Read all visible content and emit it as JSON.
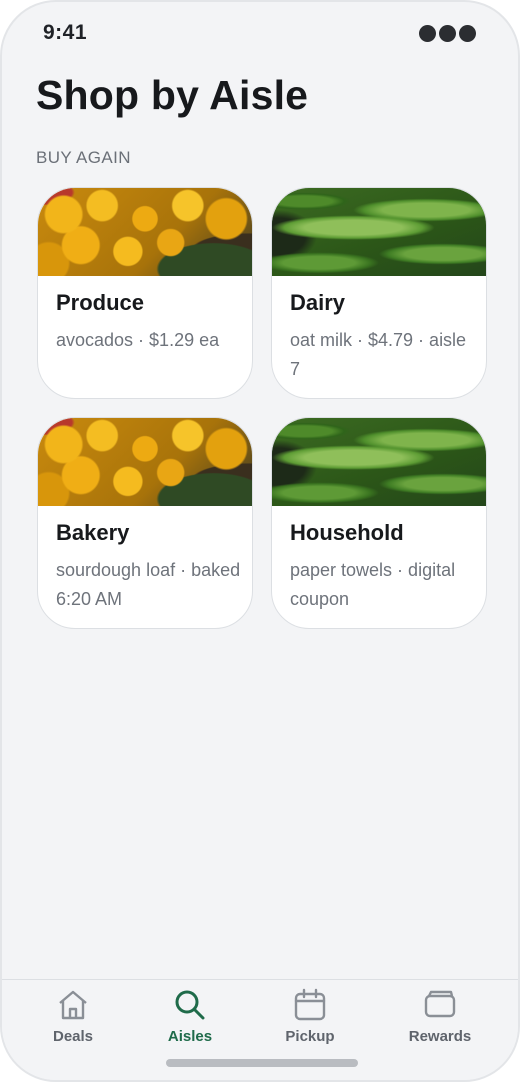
{
  "status_bar": {
    "time": "9:41"
  },
  "header": {
    "title": "Shop by Aisle"
  },
  "section": {
    "label": "BUY AGAIN"
  },
  "aisles": [
    {
      "title": "Produce",
      "subtitle": "avocados · $1.29 ea",
      "photo": "citrus-photo"
    },
    {
      "title": "Dairy",
      "subtitle": "oat milk · $4.79 · aisle 7",
      "photo": "cucumber-photo"
    },
    {
      "title": "Bakery",
      "subtitle": "sourdough loaf · baked 6:20 AM",
      "photo": "citrus-photo"
    },
    {
      "title": "Household",
      "subtitle": "paper towels · digital coupon",
      "photo": "cucumber-photo"
    }
  ],
  "tab_bar": {
    "active": "Aisles",
    "accent_color": "#1f6b4a",
    "tabs": [
      {
        "label": "Deals",
        "icon": "home-icon"
      },
      {
        "label": "Aisles",
        "icon": "search-icon"
      },
      {
        "label": "Pickup",
        "icon": "calendar-icon"
      },
      {
        "label": "Rewards",
        "icon": "wallet-icon"
      }
    ]
  }
}
